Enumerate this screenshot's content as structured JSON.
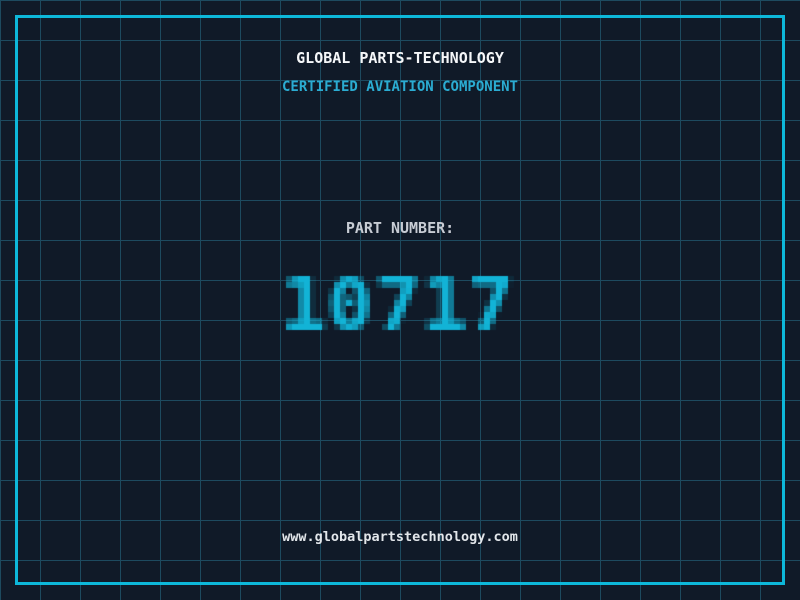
{
  "meta": {
    "background_color": "#101a28",
    "grid_color": "#1d4a5f",
    "accent_color": "#0db7d9"
  },
  "header": {
    "company_name": "GLOBAL PARTS-TECHNOLOGY",
    "tagline": "CERTIFIED AVIATION COMPONENT",
    "tagline_color": "#2bacd2"
  },
  "part": {
    "label": "PART NUMBER:",
    "number": "10717",
    "number_color": "#12b3d6"
  },
  "footer": {
    "website": "www.globalpartstechnology.com"
  }
}
